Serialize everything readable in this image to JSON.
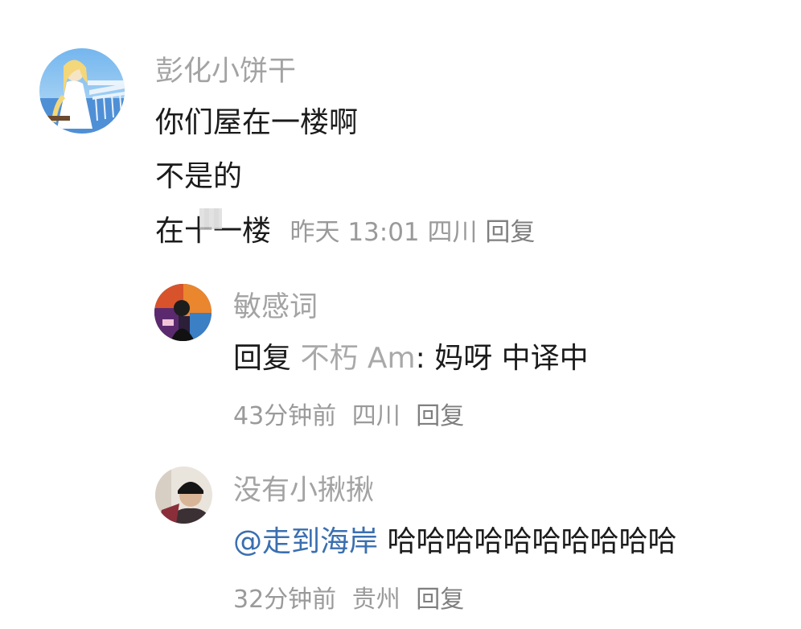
{
  "comments": [
    {
      "username": "彭化小饼干",
      "lines": [
        "你们屋在一楼啊",
        "不是的",
        "在十一楼"
      ],
      "time": "昨天 13:01",
      "location": "四川",
      "reply_label": "回复"
    }
  ],
  "replies": [
    {
      "username": "敏感词",
      "reply_prefix": "回复",
      "reply_to": "不朽 Am",
      "separator": ":",
      "text": " 妈呀 中译中",
      "time": "43分钟前",
      "location": "四川",
      "reply_label": "回复"
    },
    {
      "username": "没有小揪揪",
      "mention": "@走到海岸",
      "text": " 哈哈哈哈哈哈哈哈哈哈",
      "time": "32分钟前",
      "location": "贵州",
      "reply_label": "回复"
    }
  ],
  "icons": {
    "avatar1": "avatar-anime-girl-sea",
    "avatar2": "avatar-colorful-photo",
    "avatar3": "avatar-person-black-hat"
  }
}
